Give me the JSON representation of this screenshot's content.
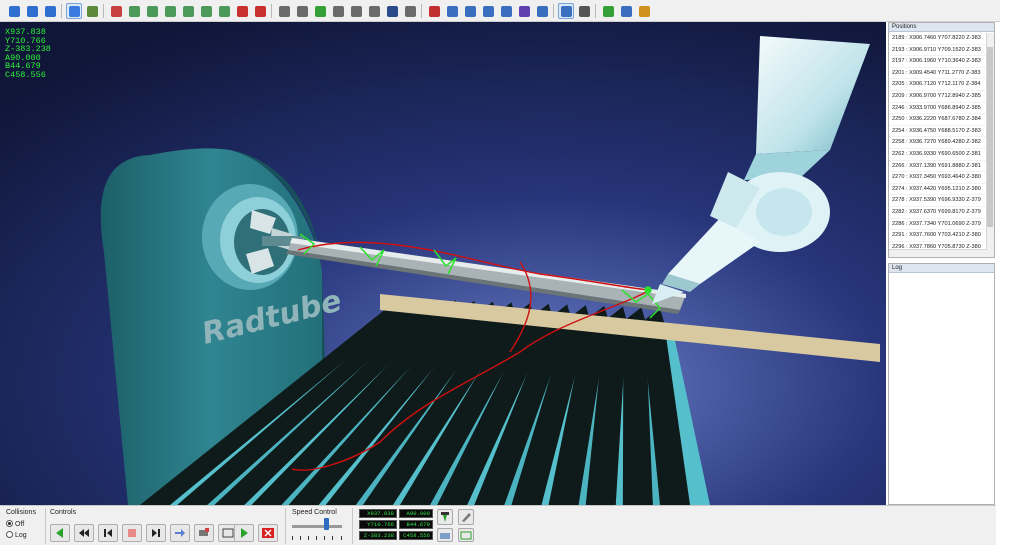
{
  "viewport": {
    "coords": [
      "X937.838",
      "Y710.766",
      "Z-383.238",
      "A90.000",
      "B44.679",
      "C458.556"
    ],
    "machine_logo": "Radtube"
  },
  "positions_panel": {
    "title": "Positions",
    "rows": [
      "2189 : X906.7460 Y707.8220 Z-383",
      "2193 : X906.9710 Y709.1520 Z-383",
      "2197 : X906.1960 Y710.3640 Z-383",
      "2201 : X909.4540 Y711.2770 Z-383",
      "2205 : X906.7120 Y712.1170 Z-384",
      "2209 : X906.9700 Y712.8940 Z-385",
      "2246 : X933.9700 Y686.8940 Z-385",
      "2250 : X936.2220 Y687.6780 Z-384",
      "2254 : X936.4750 Y688.5170 Z-383",
      "2258 : X936.7270 Y689.4280 Z-382",
      "2262 : X936.9330 Y690.6500 Z-381",
      "2266 : X937.1390 Y691.8880 Z-381",
      "2270 : X937.3450 Y693.4640 Z-380",
      "2274 : X937.4420 Y695.1210 Z-380",
      "2278 : X937.5390 Y696.9330 Z-379",
      "2282 : X937.6370 Y699.8170 Z-379",
      "2286 : X937.7340 Y701.0690 Z-379",
      "2291 : X937.7600 Y703.4210 Z-380",
      "2296 : X937.7860 Y705.8730 Z-380",
      "2301 : X937.8120 Y708.3540 Z-381",
      "2307 : X937.8380 Y710.7660 Z-383"
    ],
    "selected_index": 20
  },
  "log_panel": {
    "title": "Log"
  },
  "bottom": {
    "collisions_label": "Collisions",
    "collisions_options": [
      "Off",
      "Log"
    ],
    "collisions_selected": "Off",
    "controls_label": "Controls",
    "speed_label": "Speed Control",
    "speed_value": 0.68,
    "dro_left": [
      "X937.838",
      "Y710.766",
      "Z-383.238"
    ],
    "dro_right": [
      "A90.000",
      "B44.679",
      "C458.556"
    ]
  },
  "colors": {
    "coords_text": "#2cf23a",
    "toolpath": "#d01010",
    "marker": "#2ee02e",
    "play_green": "#2aa22a",
    "stop_red": "#d82020"
  }
}
